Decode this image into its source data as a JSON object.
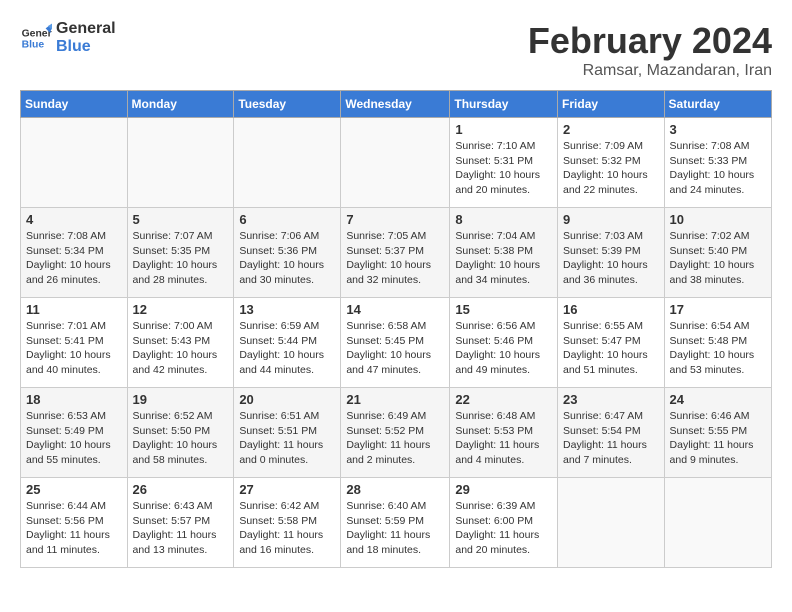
{
  "header": {
    "logo_general": "General",
    "logo_blue": "Blue",
    "month": "February 2024",
    "location": "Ramsar, Mazandaran, Iran"
  },
  "weekdays": [
    "Sunday",
    "Monday",
    "Tuesday",
    "Wednesday",
    "Thursday",
    "Friday",
    "Saturday"
  ],
  "weeks": [
    [
      {
        "day": "",
        "info": ""
      },
      {
        "day": "",
        "info": ""
      },
      {
        "day": "",
        "info": ""
      },
      {
        "day": "",
        "info": ""
      },
      {
        "day": "1",
        "info": "Sunrise: 7:10 AM\nSunset: 5:31 PM\nDaylight: 10 hours\nand 20 minutes."
      },
      {
        "day": "2",
        "info": "Sunrise: 7:09 AM\nSunset: 5:32 PM\nDaylight: 10 hours\nand 22 minutes."
      },
      {
        "day": "3",
        "info": "Sunrise: 7:08 AM\nSunset: 5:33 PM\nDaylight: 10 hours\nand 24 minutes."
      }
    ],
    [
      {
        "day": "4",
        "info": "Sunrise: 7:08 AM\nSunset: 5:34 PM\nDaylight: 10 hours\nand 26 minutes."
      },
      {
        "day": "5",
        "info": "Sunrise: 7:07 AM\nSunset: 5:35 PM\nDaylight: 10 hours\nand 28 minutes."
      },
      {
        "day": "6",
        "info": "Sunrise: 7:06 AM\nSunset: 5:36 PM\nDaylight: 10 hours\nand 30 minutes."
      },
      {
        "day": "7",
        "info": "Sunrise: 7:05 AM\nSunset: 5:37 PM\nDaylight: 10 hours\nand 32 minutes."
      },
      {
        "day": "8",
        "info": "Sunrise: 7:04 AM\nSunset: 5:38 PM\nDaylight: 10 hours\nand 34 minutes."
      },
      {
        "day": "9",
        "info": "Sunrise: 7:03 AM\nSunset: 5:39 PM\nDaylight: 10 hours\nand 36 minutes."
      },
      {
        "day": "10",
        "info": "Sunrise: 7:02 AM\nSunset: 5:40 PM\nDaylight: 10 hours\nand 38 minutes."
      }
    ],
    [
      {
        "day": "11",
        "info": "Sunrise: 7:01 AM\nSunset: 5:41 PM\nDaylight: 10 hours\nand 40 minutes."
      },
      {
        "day": "12",
        "info": "Sunrise: 7:00 AM\nSunset: 5:43 PM\nDaylight: 10 hours\nand 42 minutes."
      },
      {
        "day": "13",
        "info": "Sunrise: 6:59 AM\nSunset: 5:44 PM\nDaylight: 10 hours\nand 44 minutes."
      },
      {
        "day": "14",
        "info": "Sunrise: 6:58 AM\nSunset: 5:45 PM\nDaylight: 10 hours\nand 47 minutes."
      },
      {
        "day": "15",
        "info": "Sunrise: 6:56 AM\nSunset: 5:46 PM\nDaylight: 10 hours\nand 49 minutes."
      },
      {
        "day": "16",
        "info": "Sunrise: 6:55 AM\nSunset: 5:47 PM\nDaylight: 10 hours\nand 51 minutes."
      },
      {
        "day": "17",
        "info": "Sunrise: 6:54 AM\nSunset: 5:48 PM\nDaylight: 10 hours\nand 53 minutes."
      }
    ],
    [
      {
        "day": "18",
        "info": "Sunrise: 6:53 AM\nSunset: 5:49 PM\nDaylight: 10 hours\nand 55 minutes."
      },
      {
        "day": "19",
        "info": "Sunrise: 6:52 AM\nSunset: 5:50 PM\nDaylight: 10 hours\nand 58 minutes."
      },
      {
        "day": "20",
        "info": "Sunrise: 6:51 AM\nSunset: 5:51 PM\nDaylight: 11 hours\nand 0 minutes."
      },
      {
        "day": "21",
        "info": "Sunrise: 6:49 AM\nSunset: 5:52 PM\nDaylight: 11 hours\nand 2 minutes."
      },
      {
        "day": "22",
        "info": "Sunrise: 6:48 AM\nSunset: 5:53 PM\nDaylight: 11 hours\nand 4 minutes."
      },
      {
        "day": "23",
        "info": "Sunrise: 6:47 AM\nSunset: 5:54 PM\nDaylight: 11 hours\nand 7 minutes."
      },
      {
        "day": "24",
        "info": "Sunrise: 6:46 AM\nSunset: 5:55 PM\nDaylight: 11 hours\nand 9 minutes."
      }
    ],
    [
      {
        "day": "25",
        "info": "Sunrise: 6:44 AM\nSunset: 5:56 PM\nDaylight: 11 hours\nand 11 minutes."
      },
      {
        "day": "26",
        "info": "Sunrise: 6:43 AM\nSunset: 5:57 PM\nDaylight: 11 hours\nand 13 minutes."
      },
      {
        "day": "27",
        "info": "Sunrise: 6:42 AM\nSunset: 5:58 PM\nDaylight: 11 hours\nand 16 minutes."
      },
      {
        "day": "28",
        "info": "Sunrise: 6:40 AM\nSunset: 5:59 PM\nDaylight: 11 hours\nand 18 minutes."
      },
      {
        "day": "29",
        "info": "Sunrise: 6:39 AM\nSunset: 6:00 PM\nDaylight: 11 hours\nand 20 minutes."
      },
      {
        "day": "",
        "info": ""
      },
      {
        "day": "",
        "info": ""
      }
    ]
  ]
}
